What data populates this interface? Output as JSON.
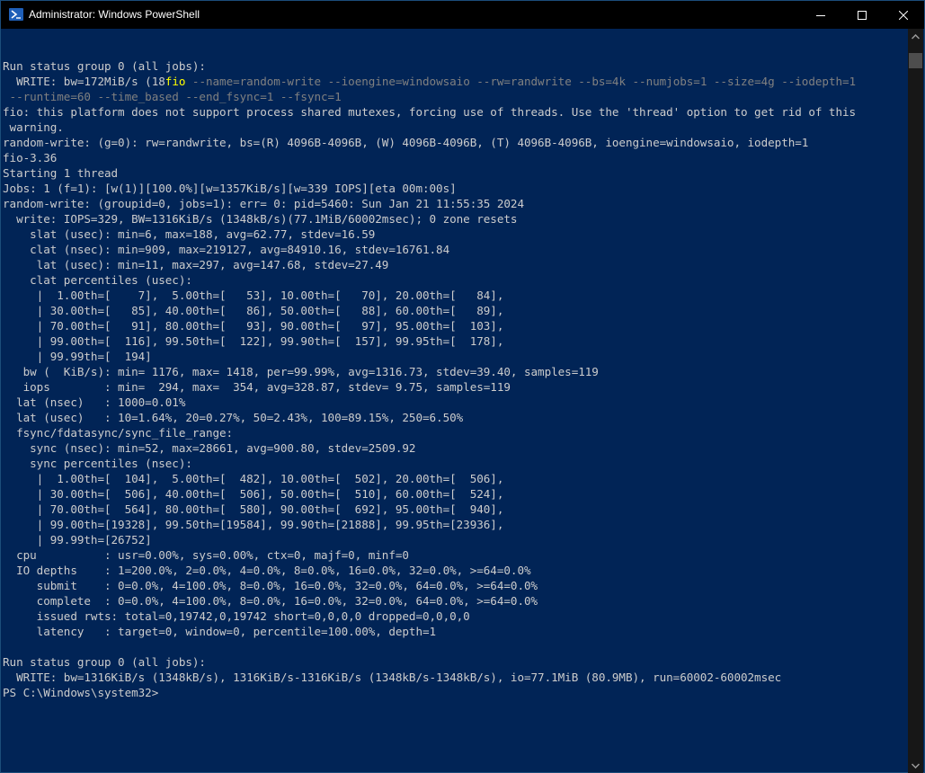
{
  "window": {
    "title": "Administrator: Windows PowerShell",
    "controls": {
      "minimize": "minimize",
      "maximize": "maximize",
      "close": "close"
    }
  },
  "console": {
    "lines": [
      "",
      "Run status group 0 (all jobs):",
      {
        "parts": [
          {
            "text": "  WRITE: bw=172MiB/s (18",
            "style": ""
          },
          {
            "text": "fio",
            "style": "yellow"
          },
          {
            "text": " --name=random-write --ioengine=windowsaio --rw=randwrite --bs=4k --numjobs=1 --size=4g --iodepth=1",
            "style": "gray"
          }
        ]
      },
      {
        "parts": [
          {
            "text": " --runtime=60 --time_based --end_fsync=1 --fsync=1",
            "style": "gray"
          }
        ]
      },
      "fio: this platform does not support process shared mutexes, forcing use of threads. Use the 'thread' option to get rid of this",
      " warning.",
      "random-write: (g=0): rw=randwrite, bs=(R) 4096B-4096B, (W) 4096B-4096B, (T) 4096B-4096B, ioengine=windowsaio, iodepth=1",
      "fio-3.36",
      "Starting 1 thread",
      "Jobs: 1 (f=1): [w(1)][100.0%][w=1357KiB/s][w=339 IOPS][eta 00m:00s]",
      "random-write: (groupid=0, jobs=1): err= 0: pid=5460: Sun Jan 21 11:55:35 2024",
      "  write: IOPS=329, BW=1316KiB/s (1348kB/s)(77.1MiB/60002msec); 0 zone resets",
      "    slat (usec): min=6, max=188, avg=62.77, stdev=16.59",
      "    clat (nsec): min=909, max=219127, avg=84910.16, stdev=16761.84",
      "     lat (usec): min=11, max=297, avg=147.68, stdev=27.49",
      "    clat percentiles (usec):",
      "     |  1.00th=[    7],  5.00th=[   53], 10.00th=[   70], 20.00th=[   84],",
      "     | 30.00th=[   85], 40.00th=[   86], 50.00th=[   88], 60.00th=[   89],",
      "     | 70.00th=[   91], 80.00th=[   93], 90.00th=[   97], 95.00th=[  103],",
      "     | 99.00th=[  116], 99.50th=[  122], 99.90th=[  157], 99.95th=[  178],",
      "     | 99.99th=[  194]",
      "   bw (  KiB/s): min= 1176, max= 1418, per=99.99%, avg=1316.73, stdev=39.40, samples=119",
      "   iops        : min=  294, max=  354, avg=328.87, stdev= 9.75, samples=119",
      "  lat (nsec)   : 1000=0.01%",
      "  lat (usec)   : 10=1.64%, 20=0.27%, 50=2.43%, 100=89.15%, 250=6.50%",
      "  fsync/fdatasync/sync_file_range:",
      "    sync (nsec): min=52, max=28661, avg=900.80, stdev=2509.92",
      "    sync percentiles (nsec):",
      "     |  1.00th=[  104],  5.00th=[  482], 10.00th=[  502], 20.00th=[  506],",
      "     | 30.00th=[  506], 40.00th=[  506], 50.00th=[  510], 60.00th=[  524],",
      "     | 70.00th=[  564], 80.00th=[  580], 90.00th=[  692], 95.00th=[  940],",
      "     | 99.00th=[19328], 99.50th=[19584], 99.90th=[21888], 99.95th=[23936],",
      "     | 99.99th=[26752]",
      "  cpu          : usr=0.00%, sys=0.00%, ctx=0, majf=0, minf=0",
      "  IO depths    : 1=200.0%, 2=0.0%, 4=0.0%, 8=0.0%, 16=0.0%, 32=0.0%, >=64=0.0%",
      "     submit    : 0=0.0%, 4=100.0%, 8=0.0%, 16=0.0%, 32=0.0%, 64=0.0%, >=64=0.0%",
      "     complete  : 0=0.0%, 4=100.0%, 8=0.0%, 16=0.0%, 32=0.0%, 64=0.0%, >=64=0.0%",
      "     issued rwts: total=0,19742,0,19742 short=0,0,0,0 dropped=0,0,0,0",
      "     latency   : target=0, window=0, percentile=100.00%, depth=1",
      "",
      "Run status group 0 (all jobs):",
      "  WRITE: bw=1316KiB/s (1348kB/s), 1316KiB/s-1316KiB/s (1348kB/s-1348kB/s), io=77.1MiB (80.9MB), run=60002-60002msec",
      "PS C:\\Windows\\system32>"
    ]
  },
  "colors": {
    "background": "#012456",
    "text": "#cccccc",
    "highlight_yellow": "#ffff00",
    "param_gray": "#808080",
    "titlebar": "#000000"
  }
}
